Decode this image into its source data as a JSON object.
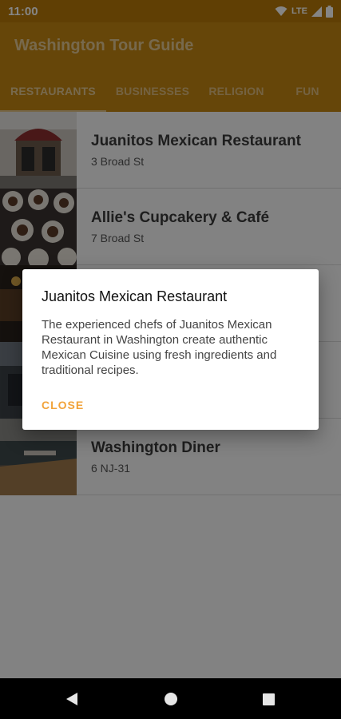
{
  "status_bar": {
    "time": "11:00",
    "network": "LTE",
    "icons": [
      "wifi-icon",
      "cell-signal-icon",
      "battery-icon"
    ]
  },
  "app_bar": {
    "title": "Washington Tour Guide",
    "tabs": [
      {
        "label": "RESTAURANTS",
        "selected": true
      },
      {
        "label": "BUSINESSES",
        "selected": false
      },
      {
        "label": "RELIGION",
        "selected": false
      },
      {
        "label": "FUN",
        "selected": false
      }
    ]
  },
  "list": {
    "items": [
      {
        "name": "Juanitos Mexican Restaurant",
        "address": "3 Broad St"
      },
      {
        "name": "Allie's Cupcakery & Café",
        "address": "7 Broad St"
      },
      {
        "name": "",
        "address": ""
      },
      {
        "name": "",
        "address": ""
      },
      {
        "name": "Washington Diner",
        "address": "6 NJ-31"
      }
    ]
  },
  "dialog": {
    "title": "Juanitos Mexican Restaurant",
    "body": "The experienced chefs of Juanitos Mexican Restaurant in Washington create authentic Mexican Cuisine using fresh ingredients and traditional recipes.",
    "close_label": "CLOSE"
  },
  "nav_bar": {
    "icons": [
      "back-icon",
      "home-icon",
      "recents-icon"
    ]
  },
  "colors": {
    "app_bar": "#c48712",
    "status_bar": "#b87a08",
    "accent": "#f2a33a"
  }
}
